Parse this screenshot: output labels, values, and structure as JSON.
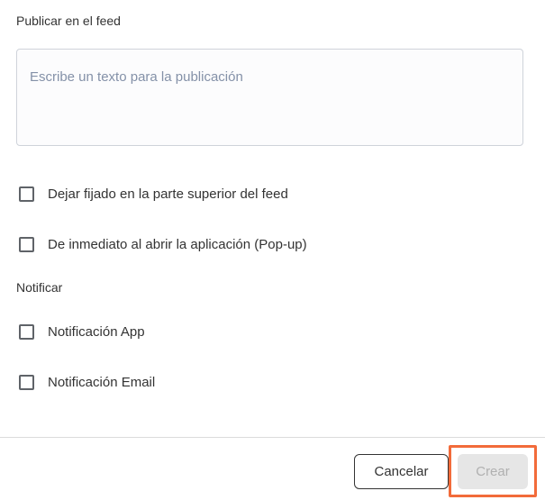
{
  "publish_section": {
    "label": "Publicar en el feed",
    "textarea_placeholder": "Escribe un texto para la publicación",
    "textarea_value": ""
  },
  "options": [
    {
      "label": "Dejar fijado en la parte superior del feed",
      "checked": false
    },
    {
      "label": "De inmediato al abrir la aplicación (Pop-up)",
      "checked": false
    }
  ],
  "notify_section": {
    "label": "Notificar",
    "options": [
      {
        "label": "Notificación App",
        "checked": false
      },
      {
        "label": "Notificación Email",
        "checked": false
      }
    ]
  },
  "footer": {
    "cancel_label": "Cancelar",
    "create_label": "Crear",
    "create_disabled": true
  },
  "colors": {
    "highlight": "#f26b3a",
    "placeholder": "#8491a8",
    "disabled_bg": "#e6e6e6",
    "disabled_text": "#b0b0b0"
  }
}
